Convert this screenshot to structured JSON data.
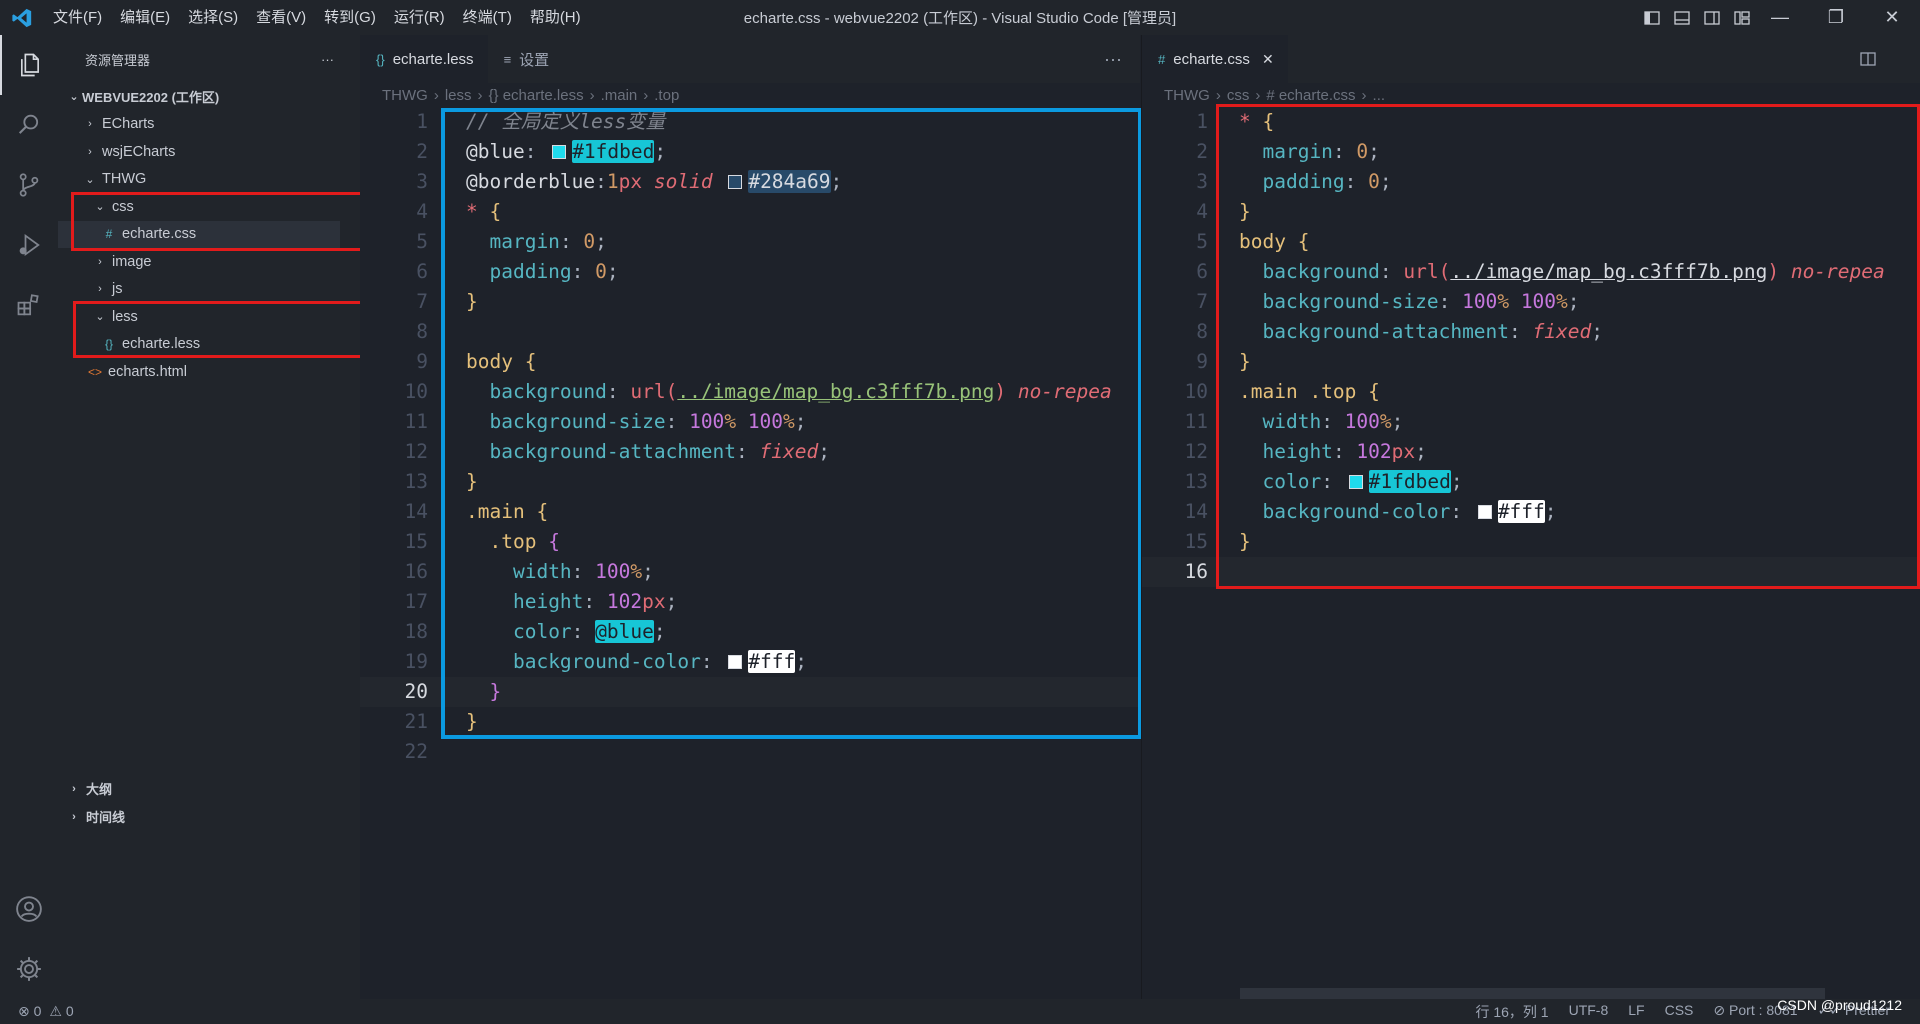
{
  "titlebar": {
    "menu": [
      "文件(F)",
      "编辑(E)",
      "选择(S)",
      "查看(V)",
      "转到(G)",
      "运行(R)",
      "终端(T)",
      "帮助(H)"
    ],
    "window_title": "echarte.css - webvue2202 (工作区) - Visual Studio Code [管理员]"
  },
  "sidebar": {
    "title": "资源管理器",
    "more": "···",
    "workspace": "WEBVUE2202 (工作区)",
    "tree": [
      {
        "label": "ECharts",
        "depth": 1,
        "chev": "›"
      },
      {
        "label": "wsjECharts",
        "depth": 1,
        "chev": "›"
      },
      {
        "label": "THWG",
        "depth": 1,
        "chev": "⌄"
      },
      {
        "label": "css",
        "depth": 2,
        "chev": "⌄"
      },
      {
        "label": "echarte.css",
        "depth": 3,
        "icon": "#"
      },
      {
        "label": "image",
        "depth": 2,
        "chev": "›"
      },
      {
        "label": "js",
        "depth": 2,
        "chev": "›"
      },
      {
        "label": "less",
        "depth": 2,
        "chev": "⌄"
      },
      {
        "label": "echarte.less",
        "depth": 3,
        "icon": "{}"
      },
      {
        "label": "echarts.html",
        "depth": 2,
        "icon": "<>"
      }
    ],
    "outline": "大纲",
    "timeline": "时间线"
  },
  "editor1": {
    "tabs": [
      {
        "icon": "{}",
        "label": "echarte.less"
      },
      {
        "icon": "≡",
        "label": "设置"
      }
    ],
    "more": "···",
    "breadcrumbs": [
      "THWG",
      "less",
      "{} echarte.less",
      ".main",
      ".top"
    ],
    "code": {
      "l1": "// 全局定义less变量",
      "l2_var": "@blue",
      "l2_val": "#1fdbed",
      "l3_var": "@borderblue",
      "l3_num": "1",
      "l3_unit": "px",
      "l3_kw": "solid",
      "l3_val": "#284a69",
      "star": "*",
      "margin": "margin",
      "padding": "padding",
      "zero": "0",
      "body": "body",
      "background": "background",
      "url_fn": "url(",
      "url_path": "../image/map_bg.c3fff7b.png",
      "url_close": ")",
      "norepeat": "no-repea",
      "bgsize": "background-size",
      "pct": "100",
      "pct_sign": "%",
      "bgatt": "background-attachment",
      "fixed": "fixed",
      "main": ".main",
      "top": ".top",
      "width": "width",
      "height": "height",
      "num102": "102",
      "px": "px",
      "color": "color",
      "color_val": "@blue",
      "bgcolor": "background-color",
      "fff": "#fff"
    }
  },
  "editor2": {
    "tab": {
      "icon": "#",
      "label": "echarte.css",
      "close": "✕"
    },
    "breadcrumbs": [
      "THWG",
      "css",
      "# echarte.css",
      "..."
    ],
    "code": {
      "star": "*",
      "margin": "margin",
      "padding": "padding",
      "zero": "0",
      "body": "body",
      "background": "background",
      "url_fn": "url(",
      "url_path": "../image/map_bg.c3fff7b.png",
      "url_close": ")",
      "norepeat": "no-repea",
      "bgsize": "background-size",
      "pct": "100",
      "pct_sign": "%",
      "bgatt": "background-attachment",
      "fixed": "fixed",
      "selector": ".main .top",
      "width": "width",
      "height": "height",
      "num102": "102",
      "px": "px",
      "color": "color",
      "color_val": "#1fdbed",
      "bgcolor": "background-color",
      "fff": "#fff"
    }
  },
  "statusbar": {
    "errors": "⊗ 0",
    "warnings": "⚠ 0",
    "position": "行 16，列 1",
    "encoding": "UTF-8",
    "eol": "LF",
    "language": "CSS",
    "port": "⊘ Port : 8081",
    "prettier": "✓✓ Prettier"
  },
  "watermark": "CSDN @proud1212",
  "colors": {
    "accent_blue": "#1fdbed",
    "border_blue": "#284a69",
    "annotation_red": "#e21b1b",
    "annotation_blue": "#0b9ae0"
  }
}
